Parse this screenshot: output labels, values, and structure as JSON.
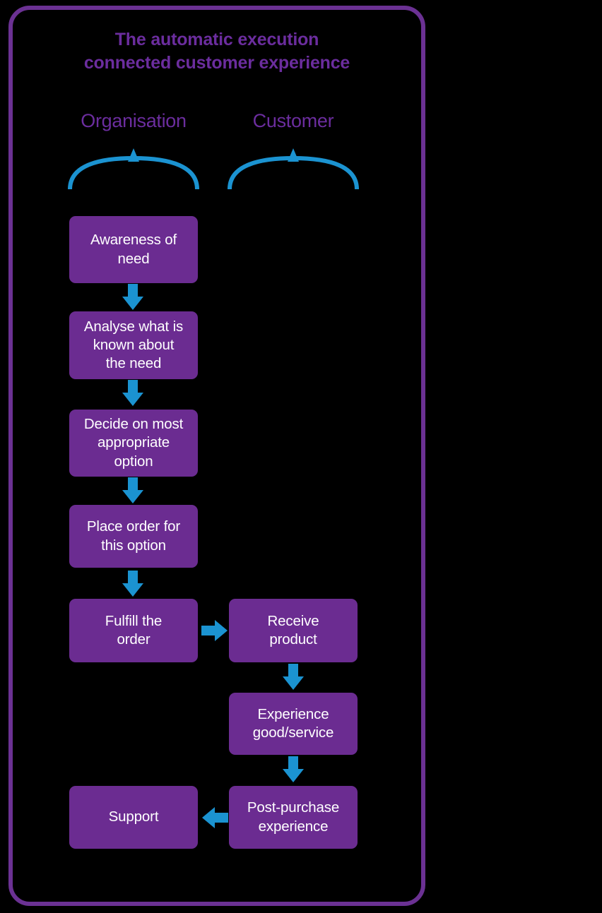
{
  "theme": {
    "background": "#000000",
    "frame_border": "#6B3193",
    "title_color": "#6B2D9E",
    "header_color": "#6B2D9E",
    "box_fill": "#6B2C91",
    "box_text": "#FFFFFF",
    "arrow_color": "#1B93D1",
    "brace_color": "#1B93D1"
  },
  "title": {
    "line1": "The automatic execution",
    "line2": "connected customer experience"
  },
  "columns": [
    {
      "id": "organisation",
      "label": "Organisation"
    },
    {
      "id": "customer",
      "label": "Customer"
    }
  ],
  "nodes": [
    {
      "id": "awareness",
      "column": "organisation",
      "label": "Awareness of\nneed"
    },
    {
      "id": "analyse",
      "column": "organisation",
      "label": "Analyse what is\nknown about\nthe need"
    },
    {
      "id": "decide",
      "column": "organisation",
      "label": "Decide on most\nappropriate\noption"
    },
    {
      "id": "place-order",
      "column": "organisation",
      "label": "Place order for\nthis option"
    },
    {
      "id": "fulfill",
      "column": "organisation",
      "label": "Fulfill the\norder"
    },
    {
      "id": "support",
      "column": "organisation",
      "label": "Support"
    },
    {
      "id": "receive-product",
      "column": "customer",
      "label": "Receive\nproduct"
    },
    {
      "id": "experience",
      "column": "customer",
      "label": "Experience\ngood/service"
    },
    {
      "id": "post-purchase",
      "column": "customer",
      "label": "Post-purchase\nexperience"
    }
  ],
  "arrows": [
    {
      "id": "awareness-to-analyse",
      "from": "awareness",
      "to": "analyse",
      "direction": "down"
    },
    {
      "id": "analyse-to-decide",
      "from": "analyse",
      "to": "decide",
      "direction": "down"
    },
    {
      "id": "decide-to-place",
      "from": "decide",
      "to": "place-order",
      "direction": "down"
    },
    {
      "id": "place-to-fulfill",
      "from": "place-order",
      "to": "fulfill",
      "direction": "down"
    },
    {
      "id": "fulfill-to-receive",
      "from": "fulfill",
      "to": "receive-product",
      "direction": "right"
    },
    {
      "id": "receive-to-experience",
      "from": "receive-product",
      "to": "experience",
      "direction": "down"
    },
    {
      "id": "experience-to-post",
      "from": "experience",
      "to": "post-purchase",
      "direction": "down"
    },
    {
      "id": "post-to-support",
      "from": "post-purchase",
      "to": "support",
      "direction": "left"
    }
  ],
  "braces": [
    {
      "id": "brace-organisation",
      "for": "organisation"
    },
    {
      "id": "brace-customer",
      "for": "customer"
    }
  ]
}
